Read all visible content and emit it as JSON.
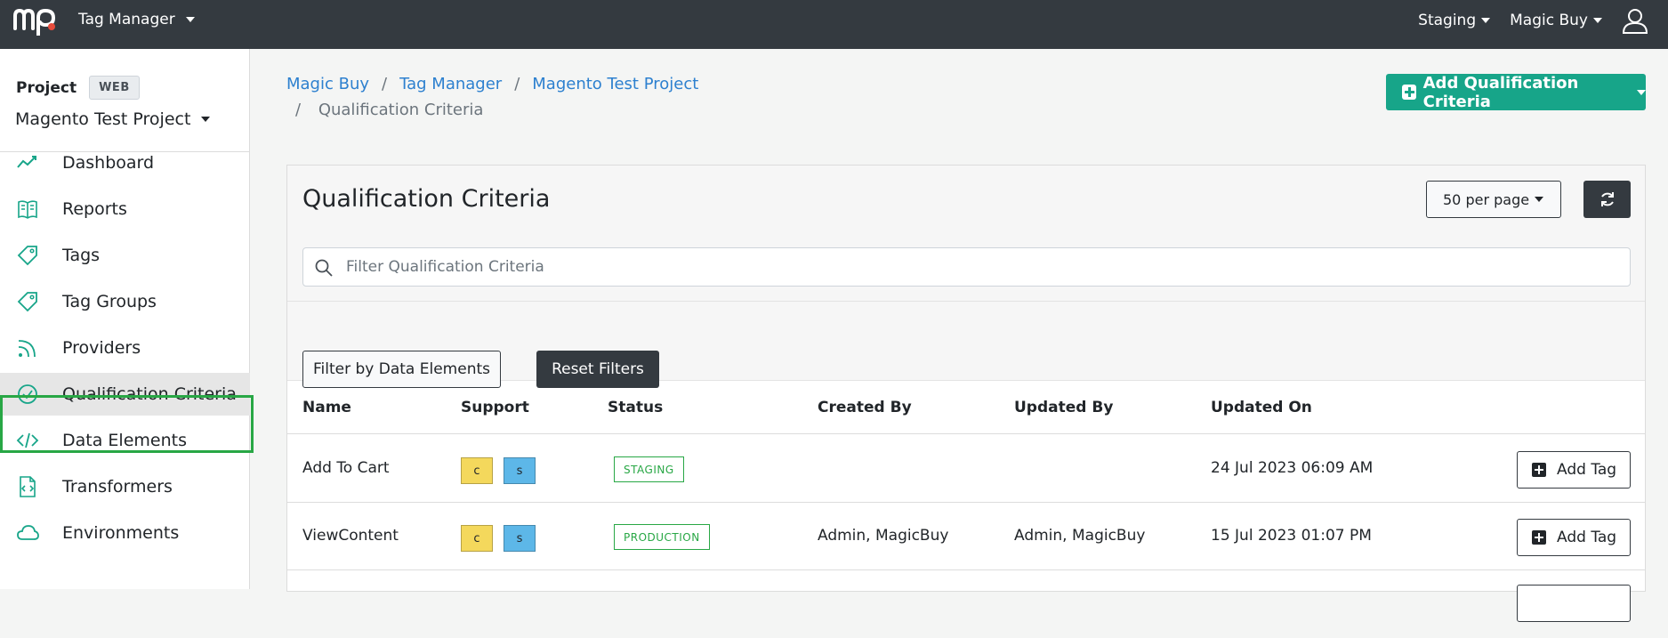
{
  "topbar": {
    "app_switch": "Tag Manager",
    "environment": "Staging",
    "account": "Magic Buy",
    "logo_icon": "mp-logo-icon",
    "user_icon": "user-icon"
  },
  "sidebar": {
    "project_label": "Project",
    "project_badge": "WEB",
    "project_name": "Magento Test Project",
    "items": [
      {
        "label": "Dashboard",
        "icon": "trend-line-icon"
      },
      {
        "label": "Reports",
        "icon": "book-icon"
      },
      {
        "label": "Tags",
        "icon": "tag-icon"
      },
      {
        "label": "Tag Groups",
        "icon": "tag-icon"
      },
      {
        "label": "Providers",
        "icon": "rss-icon"
      },
      {
        "label": "Qualification Criteria",
        "icon": "check-circle-icon"
      },
      {
        "label": "Data Elements",
        "icon": "code-icon"
      },
      {
        "label": "Transformers",
        "icon": "code-file-icon"
      },
      {
        "label": "Environments",
        "icon": "cloud-icon"
      }
    ],
    "active_item": "Qualification Criteria"
  },
  "breadcrumb": {
    "items": [
      "Magic Buy",
      "Tag Manager",
      "Magento Test Project"
    ],
    "separator": "/",
    "current": "Qualification Criteria"
  },
  "actions": {
    "add_button": "Add Qualification Criteria"
  },
  "card": {
    "title": "Qualification Criteria",
    "per_page": "50 per page",
    "filter_placeholder": "Filter Qualification Criteria",
    "filter_by_data_elements": "Filter by Data Elements",
    "reset_filters": "Reset Filters"
  },
  "table": {
    "headers": [
      "Name",
      "Support",
      "Status",
      "Created By",
      "Updated By",
      "Updated On"
    ],
    "rows": [
      {
        "name": "Add To Cart",
        "support": [
          "c",
          "s"
        ],
        "status": "STAGING",
        "created_by": "",
        "updated_by": "",
        "updated_on": "24 Jul 2023 06:09 AM",
        "action": "Add Tag"
      },
      {
        "name": "ViewContent",
        "support": [
          "c",
          "s"
        ],
        "status": "PRODUCTION",
        "created_by": "Admin, MagicBuy",
        "updated_by": "Admin, MagicBuy",
        "updated_on": "15 Jul 2023 01:07 PM",
        "action": "Add Tag"
      }
    ]
  },
  "colors": {
    "topbar": "#343a40",
    "accent": "#17a589",
    "link": "#2d80cf",
    "status_green": "#28a745",
    "chip_c": "#f4d85c",
    "chip_s": "#5db7e8",
    "highlight": "#28a745"
  }
}
